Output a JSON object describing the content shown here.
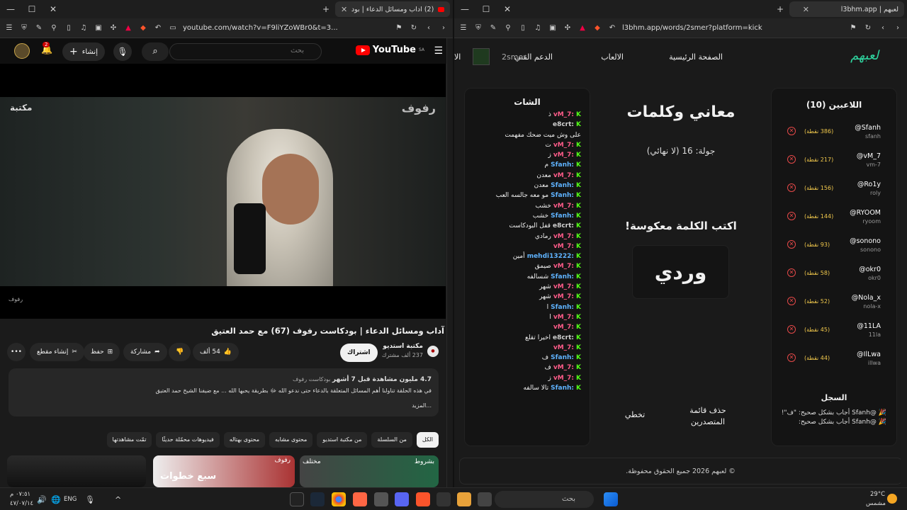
{
  "left_window": {
    "tab_title": "(2) آداب ومسائل الدعاء | بودكا...",
    "url": "youtube.com/watch?v=F9liYZoWBr0&t=3...",
    "youtube": {
      "logo": "YouTube",
      "region": "SA",
      "search_placeholder": "بحث",
      "create_label": "إنشاء",
      "notifications": "2",
      "video_brand_left": "مكتبة",
      "video_brand_right": "رفوف",
      "video_brand_sub": "رفوف",
      "title": "آداب ومسائل الدعاء | بودكاست رفوف (67) مع حمد العتيق",
      "channel_name": "مكتبة استديو",
      "subscribers": "237 ألف مشترك",
      "subscribe_label": "اشتراك",
      "likes": "54 ألف",
      "share_label": "مشاركة",
      "save_label": "حفظ",
      "clip_label": "إنشاء مقطع",
      "description_meta": "4.7 مليون مشاهدة قبل 7 أشهر",
      "description_tag": "بودكاست رفوف",
      "description_text": "في هذه الحلقة تناولنا أهم المسائل المتعلقة بالدعاء حتى ندعو الله ﷻ بطريقة يحبها الله ... مع ضيفنا الشيخ حمد العتيق",
      "description_more": "...المزيد",
      "chips": [
        "الكل",
        "من السلسلة",
        "من مكتبة استديو",
        "محتوى مشابه",
        "محتوى بهتاله",
        "فيديوهات محمّلة حديثًا",
        "تمّت مشاهدتها"
      ],
      "thumb_texts": [
        "بشروط",
        "مختلف",
        "رفوف",
        "سبع خطوات"
      ]
    }
  },
  "right_window": {
    "tab_title": "لعبهم | l3bhm.app",
    "url": "l3bhm.app/words/2smer?platform=kick",
    "app": {
      "logo": "لعبهم",
      "nav": {
        "home": "الصفحة الرئيسية",
        "games": "الالعاب",
        "support": "الدعم الفني",
        "user": "2smer",
        "more": "الا"
      },
      "players_title": "اللاعبين (10)",
      "players": [
        {
          "name": "@Sfanh",
          "user": "sfanh",
          "points": "(386 نقطة)"
        },
        {
          "name": "@vM_7",
          "user": "vm-7",
          "points": "(217 نقطة)"
        },
        {
          "name": "@Ro1y",
          "user": "roly",
          "points": "(156 نقطة)"
        },
        {
          "name": "@RYOOM",
          "user": "ryoom",
          "points": "(144 نقطة)"
        },
        {
          "name": "@sonono",
          "user": "sonono",
          "points": "(93 نقطة)"
        },
        {
          "name": "@okr0",
          "user": "okr0",
          "points": "(58 نقطة)"
        },
        {
          "name": "@Nola_x",
          "user": "nola-x",
          "points": "(52 نقطة)"
        },
        {
          "name": "@11LA",
          "user": "11la",
          "points": "(45 نقطة)"
        },
        {
          "name": "@IlLwa",
          "user": "illwa",
          "points": "(44 نقطة)"
        }
      ],
      "log_title": "السجل",
      "log": [
        "🎉 @Sfanh أجاب بشكل صحيح: \"ف\"!",
        "🎉 @Sfanh أجاب بشكل صحيح:"
      ],
      "game_title": "معاني وكلمات",
      "round": "جولة: 16 (لا نهائي)",
      "prompt": "اكتب الكلمة معكوسة!",
      "word": "وردي",
      "clear_label": "حذف قائمة المتصدرين",
      "skip_label": "تخطي",
      "chat_title": "الشات",
      "chat": [
        {
          "user": "vM_7:",
          "text": "ذ",
          "color": "#ff5c8a"
        },
        {
          "user": "e8crt:",
          "text": "",
          "color": "#d0d0d0"
        },
        {
          "user": "",
          "text": "على وش ميت ضحك مفهمت",
          "color": "#d0d0d0"
        },
        {
          "user": "vM_7:",
          "text": "ت",
          "color": "#ff5c8a"
        },
        {
          "user": "vM_7:",
          "text": "ز",
          "color": "#ff5c8a"
        },
        {
          "user": "Sfanh:",
          "text": "م",
          "color": "#5fb3ff"
        },
        {
          "user": "vM_7:",
          "text": "معدن",
          "color": "#ff5c8a"
        },
        {
          "user": "Sfanh:",
          "text": "معدن",
          "color": "#5fb3ff"
        },
        {
          "user": "Sfanh:",
          "text": "مو معه جالسه العب",
          "color": "#5fb3ff"
        },
        {
          "user": "vM_7:",
          "text": "خشب",
          "color": "#ff5c8a"
        },
        {
          "user": "Sfanh:",
          "text": "خشب",
          "color": "#5fb3ff"
        },
        {
          "user": "e8crt:",
          "text": "قفل البودكاست",
          "color": "#d0d0d0"
        },
        {
          "user": "vM_7:",
          "text": "رمادي",
          "color": "#ff5c8a"
        },
        {
          "user": "vM_7:",
          "text": "",
          "color": "#ff5c8a"
        },
        {
          "user": "mehdi13222:",
          "text": "أمين",
          "color": "#5fb3ff"
        },
        {
          "user": "vM_7:",
          "text": "صيمق",
          "color": "#ff5c8a"
        },
        {
          "user": "Sfanh:",
          "text": "شسالفه",
          "color": "#5fb3ff"
        },
        {
          "user": "vM_7:",
          "text": "شهر",
          "color": "#ff5c8a"
        },
        {
          "user": "vM_7:",
          "text": "شهر",
          "color": "#ff5c8a"
        },
        {
          "user": "Sfanh:",
          "text": "ا",
          "color": "#5fb3ff"
        },
        {
          "user": "vM_7:",
          "text": "ا",
          "color": "#ff5c8a"
        },
        {
          "user": "vM_7:",
          "text": "",
          "color": "#ff5c8a"
        },
        {
          "user": "e8crt:",
          "text": "اخيرا تقلع",
          "color": "#d0d0d0"
        },
        {
          "user": "vM_7:",
          "text": "",
          "color": "#ff5c8a"
        },
        {
          "user": "Sfanh:",
          "text": "ف",
          "color": "#5fb3ff"
        },
        {
          "user": "vM_7:",
          "text": "ف",
          "color": "#ff5c8a"
        },
        {
          "user": "vM_7:",
          "text": "ز",
          "color": "#ff5c8a"
        },
        {
          "user": "Sfanh:",
          "text": "تالا سالفه",
          "color": "#5fb3ff"
        }
      ],
      "footer": "© لعبهم 2026 جميع الحقوق محفوظة."
    }
  },
  "taskbar": {
    "time": "٠٧:٥١ م",
    "date": "٤٧/٠٧/١٤",
    "lang": "ENG",
    "search_placeholder": "بحث",
    "weather_temp": "29°C",
    "weather_desc": "مشمس"
  },
  "colors": {
    "kick": "#53fc18",
    "brand": "#2fd49f",
    "points": "#f2c94c",
    "danger": "#e54848",
    "yt_red": "#ff0000"
  }
}
